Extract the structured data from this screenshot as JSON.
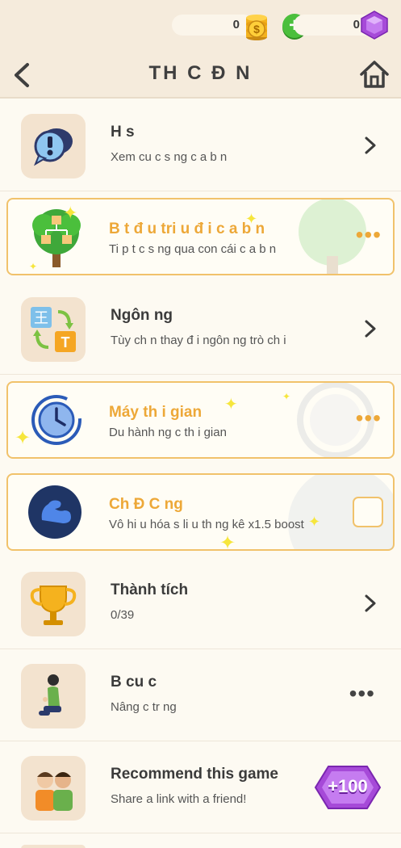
{
  "header": {
    "coins": "0",
    "gems": "0",
    "title": "TH C Đ N"
  },
  "rows": [
    {
      "title": "H s",
      "subtitle": "Xem cu c s ng c a b n",
      "icon": "profile-info-icon",
      "action": "chevron"
    },
    {
      "title": "B t đ u tri u đ i c a b n",
      "subtitle": "Ti p t c s ng qua con cái c a b n",
      "icon": "family-tree-icon",
      "action": "more",
      "highlight": true
    },
    {
      "title": "Ngôn ng",
      "subtitle": "Tùy ch n thay đ i ngôn ng trò ch i",
      "icon": "language-icon",
      "action": "chevron"
    },
    {
      "title": "Máy th i gian",
      "subtitle": "Du hành ng c th i gian",
      "icon": "time-machine-icon",
      "action": "more",
      "highlight": true
    },
    {
      "title": "Ch Đ C ng",
      "subtitle": "Vô hi u hóa s li u th ng kê x1.5 boost",
      "icon": "muscle-icon",
      "action": "checkbox",
      "highlight": true
    },
    {
      "title": "Thành tích",
      "subtitle": "0/39",
      "icon": "trophy-icon",
      "action": "chevron"
    },
    {
      "title": "B cu c",
      "subtitle": "Nâng c tr ng",
      "icon": "kneeling-person-icon",
      "action": "more"
    },
    {
      "title": "Recommend this game",
      "subtitle": "Share a link with a friend!",
      "icon": "friends-icon",
      "action": "reward",
      "reward": "+100"
    }
  ],
  "colors": {
    "accent": "#eda838",
    "highlight_border": "#f1c26b",
    "header_bg": "#f5ebdc",
    "plus": "#4bbf3c",
    "gem": "#a64ad8"
  }
}
